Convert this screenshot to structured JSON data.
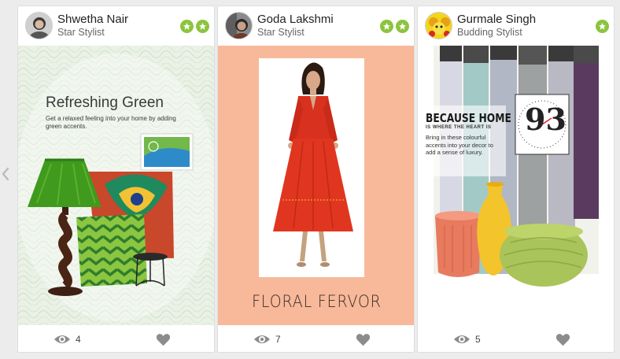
{
  "cards": [
    {
      "author": "Shwetha Nair",
      "role": "Star Stylist",
      "badges": 2,
      "title": "Refreshing Green",
      "caption": "Get a relaxed feeling into your home by adding green accents.",
      "views": "4",
      "accent": "#3c9a3c"
    },
    {
      "author": "Goda Lakshmi",
      "role": "Star Stylist",
      "badges": 2,
      "title": "FLORAL FERVOR",
      "views": "7",
      "accent": "#f7b99a"
    },
    {
      "author": "Gurmale Singh",
      "role": "Budding Stylist",
      "badges": 1,
      "title": "BECAUSE HOME",
      "subtitle": "IS WHERE THE HEART IS",
      "caption": "Bring in these colourful accents into your decor to add a sense of luxury.",
      "clock_label": "93",
      "views": "5",
      "accent": "#e9e9e0"
    }
  ],
  "colors": {
    "badge": "#8cc43e",
    "icon": "#8c8c8c"
  }
}
